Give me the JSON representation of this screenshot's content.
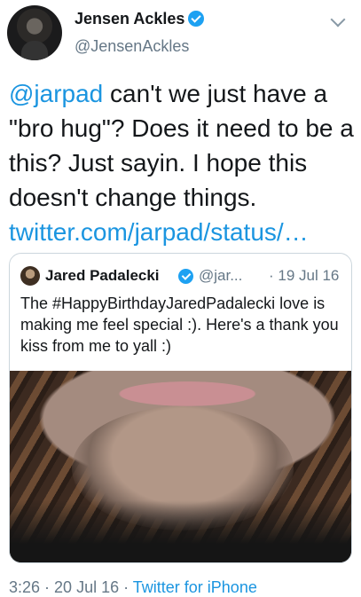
{
  "tweet": {
    "author_name": "Jensen Ackles",
    "author_handle": "@JensenAckles",
    "mention": "@jarpad",
    "text": " can't we just have a \"bro hug\"?  Does it need to be a this? Just sayin.  I hope this doesn't change things. ",
    "link": "twitter.com/jarpad/status/…",
    "time": "3:26",
    "separator1": " · ",
    "date": "20 Jul 16",
    "separator2": " · ",
    "source": "Twitter for iPhone"
  },
  "quoted_tweet": {
    "author_name": "Jared Padalecki",
    "author_handle": "@jar...",
    "date": "· 19 Jul 16",
    "text": "The #HappyBirthdayJaredPadalecki love is making me feel special :). Here's a thank you kiss from me to yall :)"
  },
  "icons": {
    "verified": "verified-badge-icon",
    "menu": "chevron-down-icon"
  },
  "colors": {
    "link": "#1b95e0",
    "verified": "#1da1f2",
    "secondary_text": "#657786"
  }
}
